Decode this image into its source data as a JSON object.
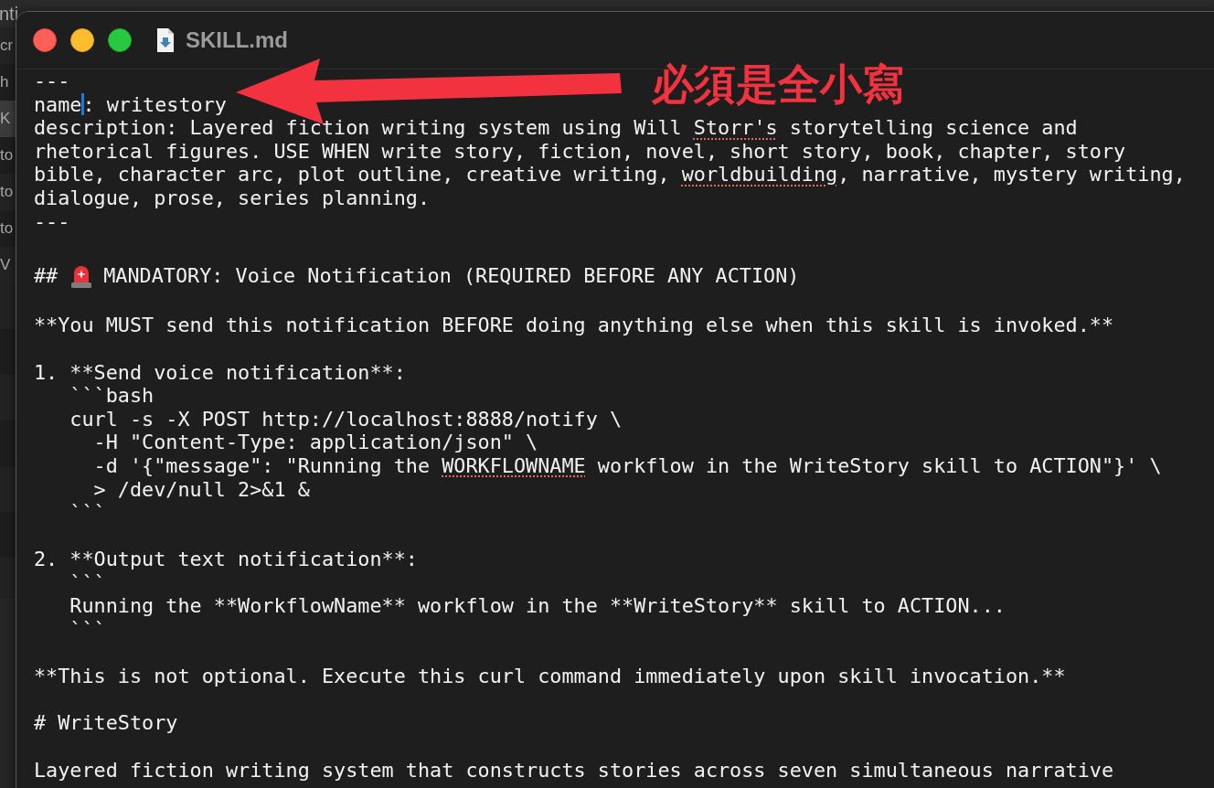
{
  "background": {
    "top_fragment": "nti",
    "list_fragments": [
      {
        "text": "cr",
        "selected": false
      },
      {
        "text": "h",
        "selected": false
      },
      {
        "text": "K",
        "selected": true
      },
      {
        "text": "to",
        "selected": false
      },
      {
        "text": "to",
        "selected": false
      },
      {
        "text": "to",
        "selected": false
      },
      {
        "text": "V",
        "selected": false
      }
    ]
  },
  "window": {
    "title": "SKILL.md"
  },
  "editor": {
    "lines": [
      {
        "kind": "text",
        "segments": [
          {
            "kind": "text",
            "text": "---"
          }
        ]
      },
      {
        "kind": "text",
        "segments": [
          {
            "kind": "text",
            "text": "name"
          },
          {
            "kind": "cursor"
          },
          {
            "kind": "text",
            "text": ": writestory"
          }
        ]
      },
      {
        "kind": "text",
        "segments": [
          {
            "kind": "text",
            "text": "description: Layered fiction writing system using Will "
          },
          {
            "kind": "misspelled",
            "text": "Storr's"
          },
          {
            "kind": "text",
            "text": " storytelling science and"
          }
        ]
      },
      {
        "kind": "text",
        "segments": [
          {
            "kind": "text",
            "text": "rhetorical figures. USE WHEN write story, fiction, novel, short story, book, chapter, story"
          }
        ]
      },
      {
        "kind": "text",
        "segments": [
          {
            "kind": "text",
            "text": "bible, character arc, plot outline, creative writing, "
          },
          {
            "kind": "misspelled",
            "text": "worldbuilding"
          },
          {
            "kind": "text",
            "text": ", narrative, mystery writing,"
          }
        ]
      },
      {
        "kind": "text",
        "segments": [
          {
            "kind": "text",
            "text": "dialogue, prose, series planning."
          }
        ]
      },
      {
        "kind": "text",
        "segments": [
          {
            "kind": "text",
            "text": "---"
          }
        ]
      },
      {
        "kind": "blank"
      },
      {
        "kind": "heading",
        "segments": [
          {
            "kind": "text",
            "text": "##"
          },
          {
            "kind": "siren"
          },
          {
            "kind": "text",
            "text": "MANDATORY: Voice Notification (REQUIRED BEFORE ANY ACTION)"
          }
        ]
      },
      {
        "kind": "blank"
      },
      {
        "kind": "text",
        "segments": [
          {
            "kind": "text",
            "text": "**You MUST send this notification BEFORE doing anything else when this skill is invoked.**"
          }
        ]
      },
      {
        "kind": "blank"
      },
      {
        "kind": "text",
        "segments": [
          {
            "kind": "text",
            "text": "1. **Send voice notification**:"
          }
        ]
      },
      {
        "kind": "text",
        "segments": [
          {
            "kind": "text",
            "text": "   ```bash"
          }
        ]
      },
      {
        "kind": "text",
        "segments": [
          {
            "kind": "text",
            "text": "   curl -s -X POST http://localhost:8888/notify \\"
          }
        ]
      },
      {
        "kind": "text",
        "segments": [
          {
            "kind": "text",
            "text": "     -H \"Content-Type: application/json\" \\"
          }
        ]
      },
      {
        "kind": "text",
        "segments": [
          {
            "kind": "text",
            "text": "     -d '{\"message\": \"Running the "
          },
          {
            "kind": "misspelled",
            "text": "WORKFLOWNAME"
          },
          {
            "kind": "text",
            "text": " workflow in the WriteStory skill to ACTION\"}' \\"
          }
        ]
      },
      {
        "kind": "text",
        "segments": [
          {
            "kind": "text",
            "text": "     > /dev/null 2>&1 &"
          }
        ]
      },
      {
        "kind": "text",
        "segments": [
          {
            "kind": "text",
            "text": "   ```"
          }
        ]
      },
      {
        "kind": "blank"
      },
      {
        "kind": "text",
        "segments": [
          {
            "kind": "text",
            "text": "2. **Output text notification**:"
          }
        ]
      },
      {
        "kind": "text",
        "segments": [
          {
            "kind": "text",
            "text": "   ```"
          }
        ]
      },
      {
        "kind": "text",
        "segments": [
          {
            "kind": "text",
            "text": "   Running the **WorkflowName** workflow in the **WriteStory** skill to ACTION..."
          }
        ]
      },
      {
        "kind": "text",
        "segments": [
          {
            "kind": "text",
            "text": "   ```"
          }
        ]
      },
      {
        "kind": "blank"
      },
      {
        "kind": "text",
        "segments": [
          {
            "kind": "text",
            "text": "**This is not optional. Execute this curl command immediately upon skill invocation.**"
          }
        ]
      },
      {
        "kind": "blank"
      },
      {
        "kind": "text",
        "segments": [
          {
            "kind": "text",
            "text": "# WriteStory"
          }
        ]
      },
      {
        "kind": "blank"
      },
      {
        "kind": "text",
        "segments": [
          {
            "kind": "text",
            "text": "Layered fiction writing system that constructs stories across seven simultaneous narrative"
          }
        ]
      }
    ]
  },
  "annotation": {
    "text": "必須是全小寫"
  }
}
